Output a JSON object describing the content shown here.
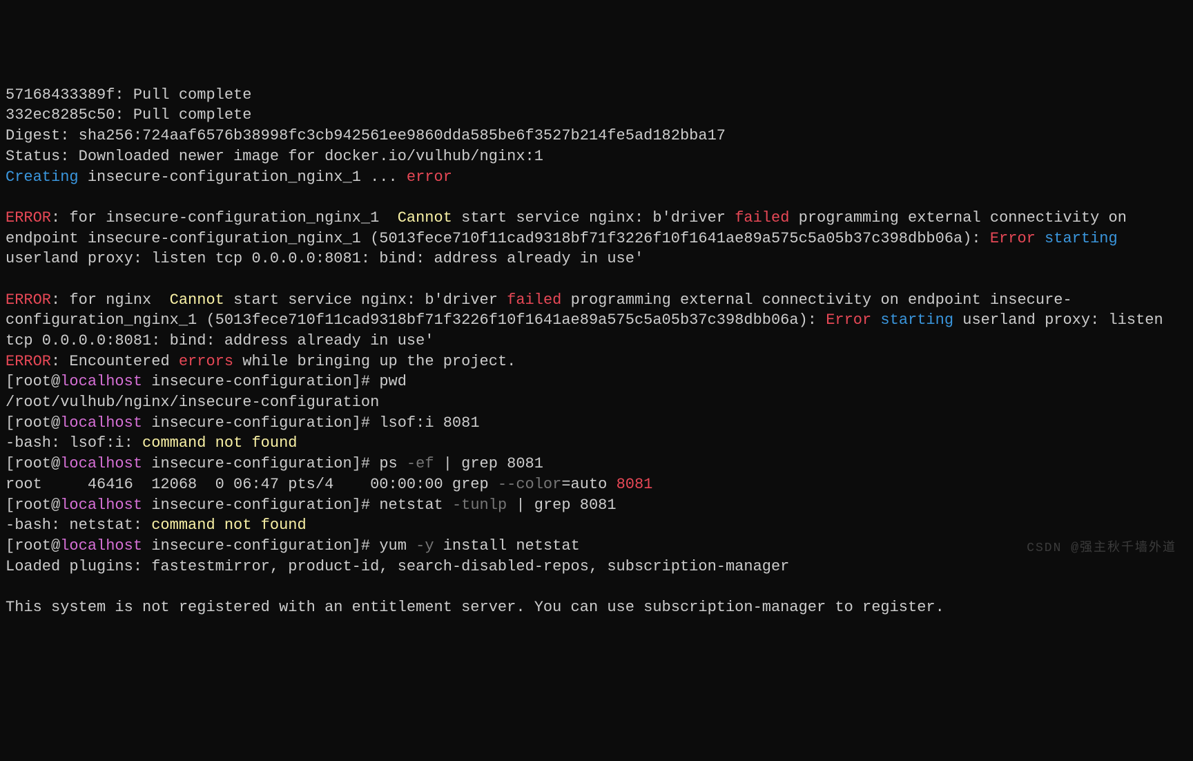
{
  "lines": {
    "l1": "57168433389f: Pull complete",
    "l2": "332ec8285c50: Pull complete",
    "l3": "Digest: sha256:724aaf6576b38998fc3cb942561ee9860dda585be6f3527b214fe5ad182bba17",
    "l4": "Status: Downloaded newer image for docker.io/vulhub/nginx:1",
    "creating": "Creating",
    "creating_name": " insecure-configuration_nginx_1 ... ",
    "error_word": "error",
    "err1_prefix": "ERROR",
    "err1_a": ": for insecure-configuration_nginx_1  ",
    "cannot": "Cannot",
    "err1_b": " start service nginx: b'driver ",
    "failed": "failed",
    "err1_c": " programming external connectivity on endpoint insecure-configuration_nginx_1 (5013fece710f11cad9318bf71f3226f10f1641ae89a575c5a05b37c398dbb06a): ",
    "error_cap": "Error",
    "starting": " starting",
    "err1_d": " userland proxy: listen tcp 0.0.0.0:8081: bind: address already in use'",
    "err2_a": ": for nginx  ",
    "err2_b": " start service nginx: b'driver ",
    "err2_c": " programming external connectivity on endpoint insecure-configuration_nginx_1 (5013fece710f11cad9318bf71f3226f10f1641ae89a575c5a05b37c398dbb06a): ",
    "err3_a": ": Encountered ",
    "errors": "errors",
    "err3_b": " while bringing up the project.",
    "prompt_open": "[root@",
    "host": "localhost",
    "prompt_dir": " insecure-configuration]# ",
    "cmd_pwd": "pwd",
    "pwd_out": "/root/vulhub/nginx/insecure-configuration",
    "cmd_lsof": "lsof:i 8081",
    "lsof_out_a": "-bash: lsof:i: ",
    "cmd_not_found": "command not found",
    "cmd_ps_a": "ps ",
    "cmd_ps_flag": "-ef",
    "cmd_ps_b": " | grep 8081",
    "ps_out_a": "root     46416  12068  0 06:47 pts/4    00:00:00 grep ",
    "ps_out_flag": "--color",
    "ps_out_b": "=auto ",
    "ps_out_port": "8081",
    "cmd_netstat_a": "netstat ",
    "cmd_netstat_flag": "-tunlp",
    "cmd_netstat_b": " | grep 8081",
    "netstat_out_a": "-bash: netstat: ",
    "cmd_yum_a": "yum ",
    "cmd_yum_flag": "-y",
    "cmd_yum_b": " install netstat",
    "yum_out1": "Loaded plugins: fastestmirror, product-id, search-disabled-repos, subscription-manager",
    "yum_out2": "This system is not registered with an entitlement server. You can use subscription-manager to register."
  },
  "watermark": "CSDN @强主秋千墙外道"
}
